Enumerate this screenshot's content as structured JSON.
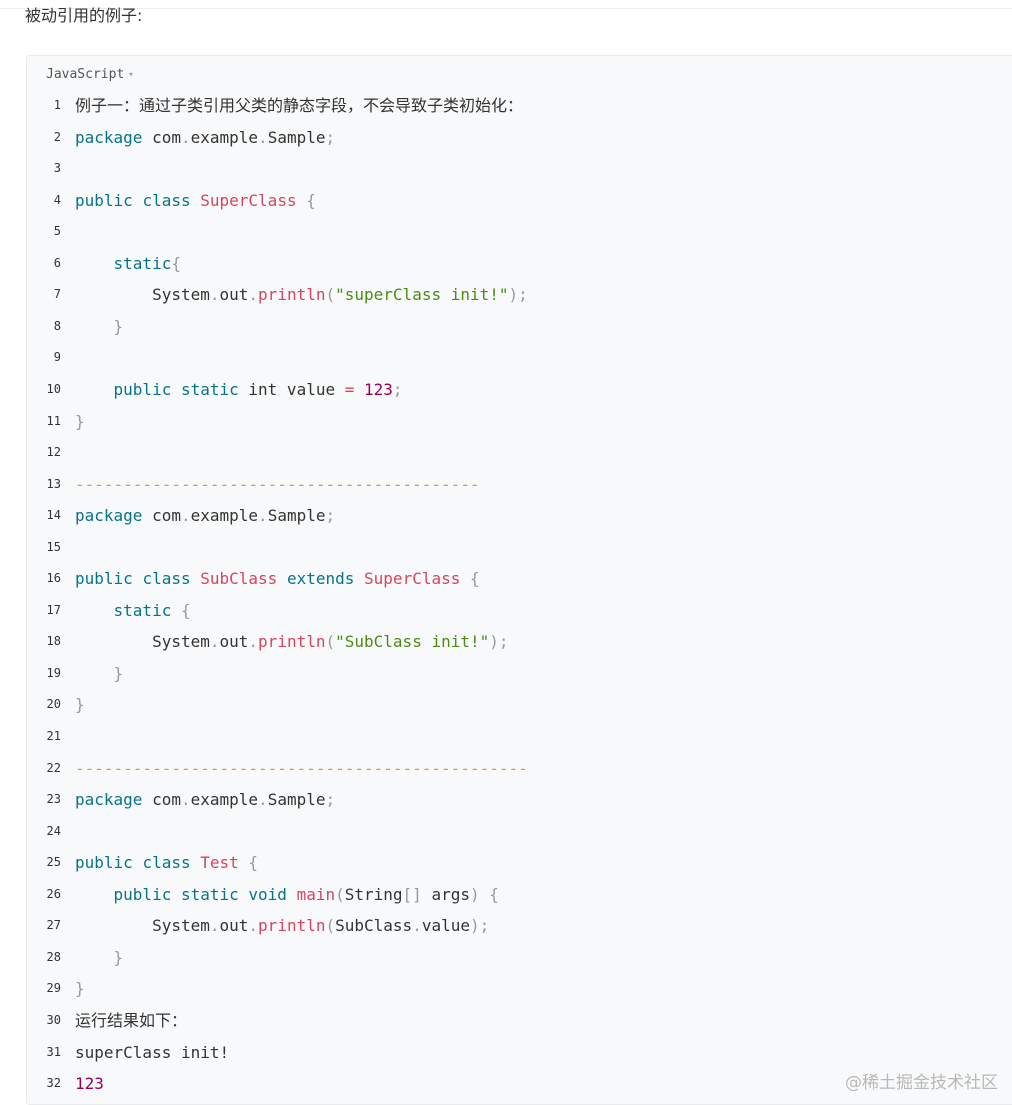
{
  "intro_text": "被动引用的例子:",
  "code_block": {
    "language": "JavaScript",
    "caret": "▾",
    "lines": [
      {
        "n": "1",
        "t": [
          {
            "c": "cn",
            "v": "例子一：通过子类引用父类的静态字段，不会导致子类初始化："
          }
        ]
      },
      {
        "n": "2",
        "t": [
          {
            "c": "kw",
            "v": "package"
          },
          {
            "c": "",
            "v": " com"
          },
          {
            "c": "pun",
            "v": "."
          },
          {
            "c": "",
            "v": "example"
          },
          {
            "c": "pun",
            "v": "."
          },
          {
            "c": "",
            "v": "Sample"
          },
          {
            "c": "pun",
            "v": ";"
          }
        ]
      },
      {
        "n": "3",
        "t": []
      },
      {
        "n": "4",
        "t": [
          {
            "c": "kw",
            "v": "public"
          },
          {
            "c": "",
            "v": " "
          },
          {
            "c": "kw",
            "v": "class"
          },
          {
            "c": "",
            "v": " "
          },
          {
            "c": "cls",
            "v": "SuperClass"
          },
          {
            "c": "",
            "v": " "
          },
          {
            "c": "pun",
            "v": "{"
          }
        ]
      },
      {
        "n": "5",
        "t": []
      },
      {
        "n": "6",
        "t": [
          {
            "c": "",
            "v": "    "
          },
          {
            "c": "kw",
            "v": "static"
          },
          {
            "c": "pun",
            "v": "{"
          }
        ]
      },
      {
        "n": "7",
        "t": [
          {
            "c": "",
            "v": "        System"
          },
          {
            "c": "pun",
            "v": "."
          },
          {
            "c": "",
            "v": "out"
          },
          {
            "c": "pun",
            "v": "."
          },
          {
            "c": "fn",
            "v": "println"
          },
          {
            "c": "pun",
            "v": "("
          },
          {
            "c": "str",
            "v": "\"superClass init!\""
          },
          {
            "c": "pun",
            "v": ");"
          }
        ]
      },
      {
        "n": "8",
        "t": [
          {
            "c": "",
            "v": "    "
          },
          {
            "c": "pun",
            "v": "}"
          }
        ]
      },
      {
        "n": "9",
        "t": []
      },
      {
        "n": "10",
        "t": [
          {
            "c": "",
            "v": "    "
          },
          {
            "c": "kw",
            "v": "public"
          },
          {
            "c": "",
            "v": " "
          },
          {
            "c": "kw",
            "v": "static"
          },
          {
            "c": "",
            "v": " int value "
          },
          {
            "c": "fn",
            "v": "="
          },
          {
            "c": "",
            "v": " "
          },
          {
            "c": "num",
            "v": "123"
          },
          {
            "c": "pun",
            "v": ";"
          }
        ]
      },
      {
        "n": "11",
        "t": [
          {
            "c": "pun",
            "v": "}"
          }
        ]
      },
      {
        "n": "12",
        "t": []
      },
      {
        "n": "13",
        "t": [
          {
            "c": "sep",
            "v": "------------------------------------------"
          }
        ]
      },
      {
        "n": "14",
        "t": [
          {
            "c": "kw",
            "v": "package"
          },
          {
            "c": "",
            "v": " com"
          },
          {
            "c": "pun",
            "v": "."
          },
          {
            "c": "",
            "v": "example"
          },
          {
            "c": "pun",
            "v": "."
          },
          {
            "c": "",
            "v": "Sample"
          },
          {
            "c": "pun",
            "v": ";"
          }
        ]
      },
      {
        "n": "15",
        "t": []
      },
      {
        "n": "16",
        "t": [
          {
            "c": "kw",
            "v": "public"
          },
          {
            "c": "",
            "v": " "
          },
          {
            "c": "kw",
            "v": "class"
          },
          {
            "c": "",
            "v": " "
          },
          {
            "c": "cls",
            "v": "SubClass"
          },
          {
            "c": "",
            "v": " "
          },
          {
            "c": "kw",
            "v": "extends"
          },
          {
            "c": "",
            "v": " "
          },
          {
            "c": "cls",
            "v": "SuperClass"
          },
          {
            "c": "",
            "v": " "
          },
          {
            "c": "pun",
            "v": "{"
          }
        ]
      },
      {
        "n": "17",
        "t": [
          {
            "c": "",
            "v": "    "
          },
          {
            "c": "kw",
            "v": "static"
          },
          {
            "c": "",
            "v": " "
          },
          {
            "c": "pun",
            "v": "{"
          }
        ]
      },
      {
        "n": "18",
        "t": [
          {
            "c": "",
            "v": "        System"
          },
          {
            "c": "pun",
            "v": "."
          },
          {
            "c": "",
            "v": "out"
          },
          {
            "c": "pun",
            "v": "."
          },
          {
            "c": "fn",
            "v": "println"
          },
          {
            "c": "pun",
            "v": "("
          },
          {
            "c": "str",
            "v": "\"SubClass init!\""
          },
          {
            "c": "pun",
            "v": ");"
          }
        ]
      },
      {
        "n": "19",
        "t": [
          {
            "c": "",
            "v": "    "
          },
          {
            "c": "pun",
            "v": "}"
          }
        ]
      },
      {
        "n": "20",
        "t": [
          {
            "c": "pun",
            "v": "}"
          }
        ]
      },
      {
        "n": "21",
        "t": []
      },
      {
        "n": "22",
        "t": [
          {
            "c": "sep",
            "v": "-----------------------------------------------"
          }
        ]
      },
      {
        "n": "23",
        "t": [
          {
            "c": "kw",
            "v": "package"
          },
          {
            "c": "",
            "v": " com"
          },
          {
            "c": "pun",
            "v": "."
          },
          {
            "c": "",
            "v": "example"
          },
          {
            "c": "pun",
            "v": "."
          },
          {
            "c": "",
            "v": "Sample"
          },
          {
            "c": "pun",
            "v": ";"
          }
        ]
      },
      {
        "n": "24",
        "t": []
      },
      {
        "n": "25",
        "t": [
          {
            "c": "kw",
            "v": "public"
          },
          {
            "c": "",
            "v": " "
          },
          {
            "c": "kw",
            "v": "class"
          },
          {
            "c": "",
            "v": " "
          },
          {
            "c": "cls",
            "v": "Test"
          },
          {
            "c": "",
            "v": " "
          },
          {
            "c": "pun",
            "v": "{"
          }
        ]
      },
      {
        "n": "26",
        "t": [
          {
            "c": "",
            "v": "    "
          },
          {
            "c": "kw",
            "v": "public"
          },
          {
            "c": "",
            "v": " "
          },
          {
            "c": "kw",
            "v": "static"
          },
          {
            "c": "",
            "v": " "
          },
          {
            "c": "kw",
            "v": "void"
          },
          {
            "c": "",
            "v": " "
          },
          {
            "c": "fn",
            "v": "main"
          },
          {
            "c": "pun",
            "v": "("
          },
          {
            "c": "",
            "v": "String"
          },
          {
            "c": "pun",
            "v": "[]"
          },
          {
            "c": "",
            "v": " args"
          },
          {
            "c": "pun",
            "v": ")"
          },
          {
            "c": "",
            "v": " "
          },
          {
            "c": "pun",
            "v": "{"
          }
        ]
      },
      {
        "n": "27",
        "t": [
          {
            "c": "",
            "v": "        System"
          },
          {
            "c": "pun",
            "v": "."
          },
          {
            "c": "",
            "v": "out"
          },
          {
            "c": "pun",
            "v": "."
          },
          {
            "c": "fn",
            "v": "println"
          },
          {
            "c": "pun",
            "v": "("
          },
          {
            "c": "",
            "v": "SubClass"
          },
          {
            "c": "pun",
            "v": "."
          },
          {
            "c": "",
            "v": "value"
          },
          {
            "c": "pun",
            "v": ");"
          }
        ]
      },
      {
        "n": "28",
        "t": [
          {
            "c": "",
            "v": "    "
          },
          {
            "c": "pun",
            "v": "}"
          }
        ]
      },
      {
        "n": "29",
        "t": [
          {
            "c": "pun",
            "v": "}"
          }
        ]
      },
      {
        "n": "30",
        "t": [
          {
            "c": "cn",
            "v": "运行结果如下："
          }
        ]
      },
      {
        "n": "31",
        "t": [
          {
            "c": "",
            "v": "superClass init!"
          }
        ]
      },
      {
        "n": "32",
        "t": [
          {
            "c": "num",
            "v": "123"
          }
        ]
      }
    ]
  },
  "watermark": "@稀土掘金技术社区",
  "colors": {
    "keyword": "#07738a",
    "class_name": "#d6455d",
    "string": "#4d8b14",
    "number": "#990055",
    "punctuation": "#999999",
    "separator": "#d69e3f",
    "code_background": "#f8f9fa"
  }
}
